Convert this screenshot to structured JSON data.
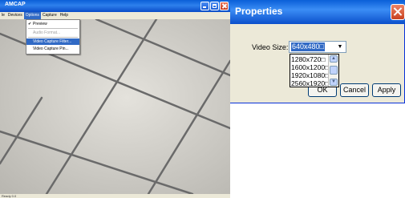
{
  "amcap": {
    "title": "AMCAP",
    "menu": [
      "le",
      "Devices",
      "Options",
      "Capture",
      "Help"
    ],
    "options_menu": [
      {
        "label": "Preview",
        "checked": true,
        "state": "normal"
      },
      {
        "label": "Audio Format...",
        "checked": false,
        "state": "disabled"
      },
      {
        "label": "Video Capture Filter...",
        "checked": false,
        "state": "highlighted"
      },
      {
        "label": "Video Capture Pin...",
        "checked": false,
        "state": "normal"
      }
    ],
    "check_mark": "✔",
    "status_text": "Ready 0.0"
  },
  "properties": {
    "title": "Properties",
    "video_size_label": "Video Size:",
    "video_size_value": "640x480□",
    "dropdown_arrow": "▼",
    "options": [
      "1280x720□",
      "1600x1200□",
      "1920x1080□",
      "2560x1920□"
    ],
    "scroll_up": "▲",
    "scroll_down": "▼",
    "buttons": {
      "ok": "OK",
      "cancel": "Cancel",
      "apply": "Apply"
    }
  },
  "colors": {
    "titlebar": "#0a5fd8",
    "highlight": "#316ac5",
    "dialog_bg": "#ece9d8",
    "close": "#c8411f"
  }
}
